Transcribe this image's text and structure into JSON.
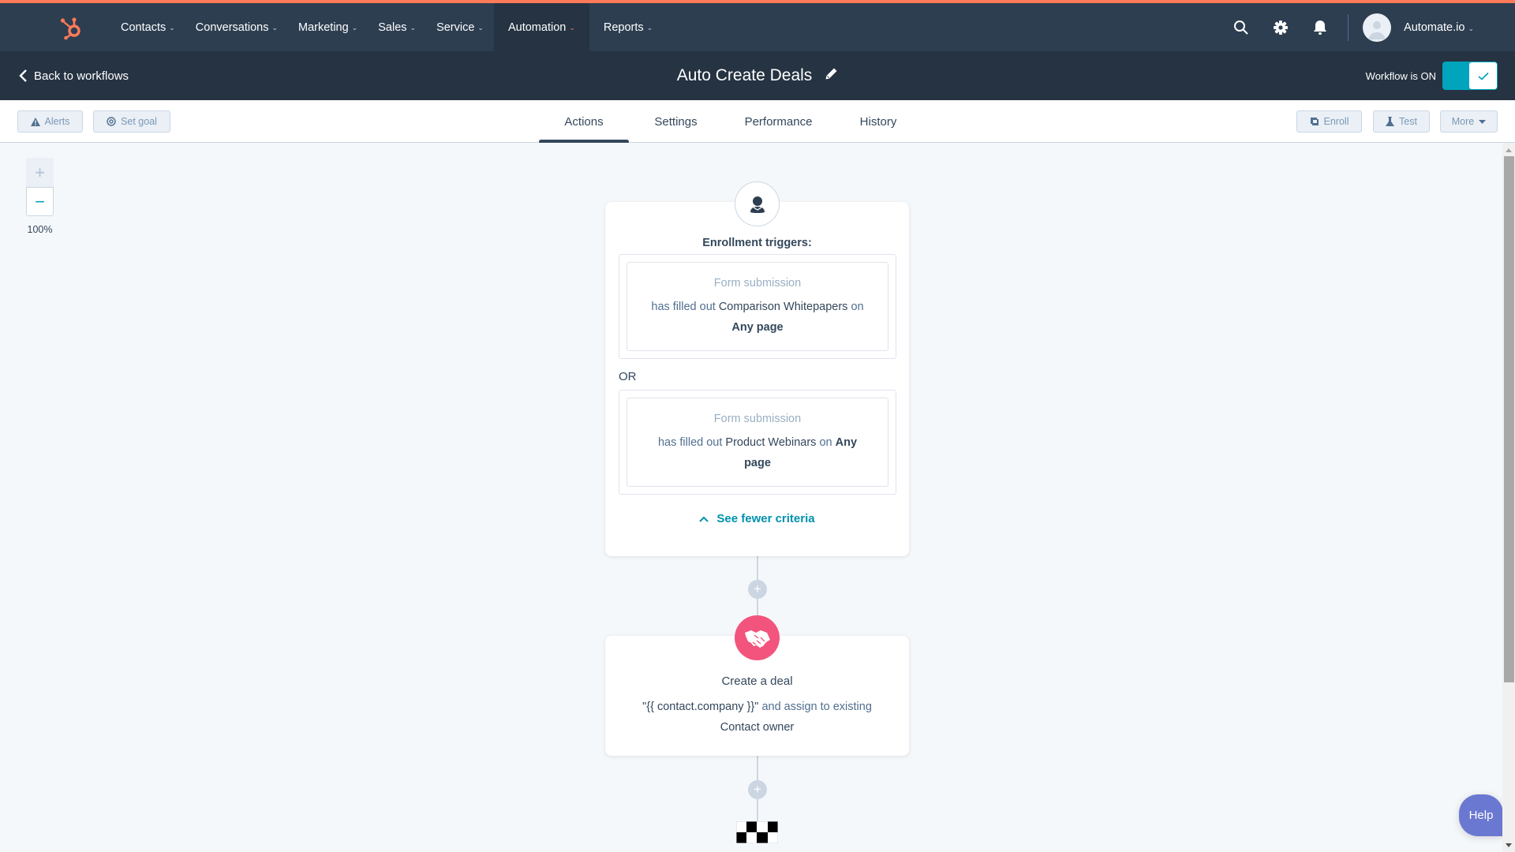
{
  "nav": {
    "items": [
      {
        "label": "Contacts",
        "active": false
      },
      {
        "label": "Conversations",
        "active": false
      },
      {
        "label": "Marketing",
        "active": false
      },
      {
        "label": "Sales",
        "active": false
      },
      {
        "label": "Service",
        "active": false
      },
      {
        "label": "Automation",
        "active": true
      },
      {
        "label": "Reports",
        "active": false
      }
    ],
    "account_name": "Automate.io",
    "brand_color": "#ff7a59",
    "icons": [
      "hubspot-logo-icon",
      "search-icon",
      "gear-icon",
      "bell-icon",
      "avatar-icon"
    ]
  },
  "subheader": {
    "back_label": "Back to workflows",
    "workflow_title": "Auto Create Deals",
    "toggle_label": "Workflow is ON",
    "toggle_on": true,
    "toggle_color": "#00a4bd"
  },
  "toolbar": {
    "alerts_label": "Alerts",
    "set_goal_label": "Set goal",
    "tabs": [
      {
        "label": "Actions",
        "active": true
      },
      {
        "label": "Settings",
        "active": false
      },
      {
        "label": "Performance",
        "active": false
      },
      {
        "label": "History",
        "active": false
      }
    ],
    "enroll_label": "Enroll",
    "test_label": "Test",
    "more_label": "More"
  },
  "canvas": {
    "zoom_level": "100%",
    "zoom_in": "+",
    "zoom_out": "−"
  },
  "trigger": {
    "title": "Enrollment triggers:",
    "or_label": "OR",
    "criteria": [
      {
        "type": "Form submission",
        "prefix": "has filled out",
        "form": "Comparison Whitepapers",
        "on": "on",
        "page": "Any page"
      },
      {
        "type": "Form submission",
        "prefix": "has filled out",
        "form": "Product Webinars",
        "on": "on",
        "page_a": "Any",
        "page_b": "page"
      }
    ],
    "see_fewer_label": "See fewer criteria"
  },
  "action": {
    "title": "Create a deal",
    "deal_name": "\"{{ contact.company }}\"",
    "assign_text": "and assign to existing",
    "owner": "Contact owner",
    "icon_color": "#f2547d"
  },
  "add_step_label": "+",
  "help_label": "Help",
  "help_color": "#6a78d1"
}
